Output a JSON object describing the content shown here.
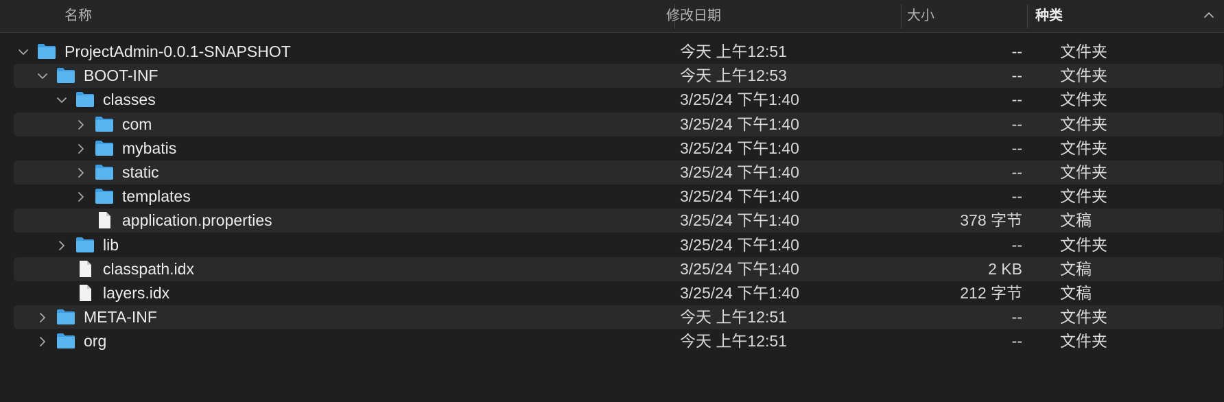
{
  "header": {
    "name_label": "名称",
    "date_label": "修改日期",
    "size_label": "大小",
    "kind_label": "种类"
  },
  "rows": [
    {
      "name": "ProjectAdmin-0.0.1-SNAPSHOT",
      "date": "今天 上午12:51",
      "size": "--",
      "kind": "文件夹",
      "level": 0,
      "expanded": true,
      "type": "folder"
    },
    {
      "name": "BOOT-INF",
      "date": "今天 上午12:53",
      "size": "--",
      "kind": "文件夹",
      "level": 1,
      "expanded": true,
      "type": "folder"
    },
    {
      "name": "classes",
      "date": "3/25/24 下午1:40",
      "size": "--",
      "kind": "文件夹",
      "level": 2,
      "expanded": true,
      "type": "folder"
    },
    {
      "name": "com",
      "date": "3/25/24 下午1:40",
      "size": "--",
      "kind": "文件夹",
      "level": 3,
      "expanded": false,
      "type": "folder"
    },
    {
      "name": "mybatis",
      "date": "3/25/24 下午1:40",
      "size": "--",
      "kind": "文件夹",
      "level": 3,
      "expanded": false,
      "type": "folder"
    },
    {
      "name": "static",
      "date": "3/25/24 下午1:40",
      "size": "--",
      "kind": "文件夹",
      "level": 3,
      "expanded": false,
      "type": "folder"
    },
    {
      "name": "templates",
      "date": "3/25/24 下午1:40",
      "size": "--",
      "kind": "文件夹",
      "level": 3,
      "expanded": false,
      "type": "folder"
    },
    {
      "name": "application.properties",
      "date": "3/25/24 下午1:40",
      "size": "378 字节",
      "kind": "文稿",
      "level": 3,
      "expanded": false,
      "type": "file"
    },
    {
      "name": "lib",
      "date": "3/25/24 下午1:40",
      "size": "--",
      "kind": "文件夹",
      "level": 2,
      "expanded": false,
      "type": "folder"
    },
    {
      "name": "classpath.idx",
      "date": "3/25/24 下午1:40",
      "size": "2 KB",
      "kind": "文稿",
      "level": 2,
      "expanded": false,
      "type": "file"
    },
    {
      "name": "layers.idx",
      "date": "3/25/24 下午1:40",
      "size": "212 字节",
      "kind": "文稿",
      "level": 2,
      "expanded": false,
      "type": "file"
    },
    {
      "name": "META-INF",
      "date": "今天 上午12:51",
      "size": "--",
      "kind": "文件夹",
      "level": 1,
      "expanded": false,
      "type": "folder"
    },
    {
      "name": "org",
      "date": "今天 上午12:51",
      "size": "--",
      "kind": "文件夹",
      "level": 1,
      "expanded": false,
      "type": "folder"
    }
  ],
  "colors": {
    "folder": "#5ab4f0",
    "folder_tab": "#3e9ee0",
    "file": "#f2f2f2",
    "background": "#1f1f1f",
    "alt_row": "#2a2a2a"
  },
  "icons": {
    "folder": "folder-icon",
    "file": "document-icon",
    "expanded": "chevron-down-icon",
    "collapsed": "chevron-right-icon",
    "sort": "chevron-up-icon"
  }
}
